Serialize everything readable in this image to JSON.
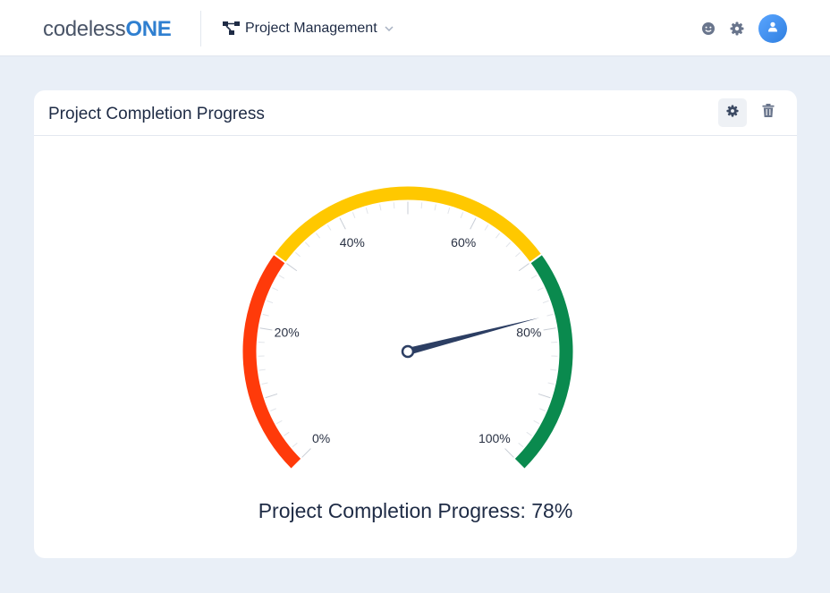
{
  "brand": {
    "name_part1": "codeless",
    "name_part2": "ONE"
  },
  "app_switcher": {
    "label": "Project Management"
  },
  "widget": {
    "title": "Project Completion Progress",
    "caption": "Project Completion Progress: 78%"
  },
  "chart_data": {
    "type": "gauge",
    "value": 78,
    "min": 0,
    "max": 100,
    "tick_labels": [
      "0%",
      "20%",
      "40%",
      "60%",
      "80%",
      "100%"
    ],
    "bands": [
      {
        "from": 0,
        "to": 30,
        "color": "#ff3a0a"
      },
      {
        "from": 30,
        "to": 70,
        "color": "#ffc800"
      },
      {
        "from": 70,
        "to": 100,
        "color": "#0a8a4e"
      }
    ],
    "needle_color": "#2c3e63"
  },
  "colors": {
    "accent": "#2f7fd0",
    "background": "#e9eff7"
  },
  "icons": {
    "app": "hierarchy-icon",
    "feedback": "smiley-icon",
    "settings": "gear-icon",
    "user": "user-icon",
    "widget_settings": "gear-icon",
    "widget_delete": "trash-icon"
  }
}
